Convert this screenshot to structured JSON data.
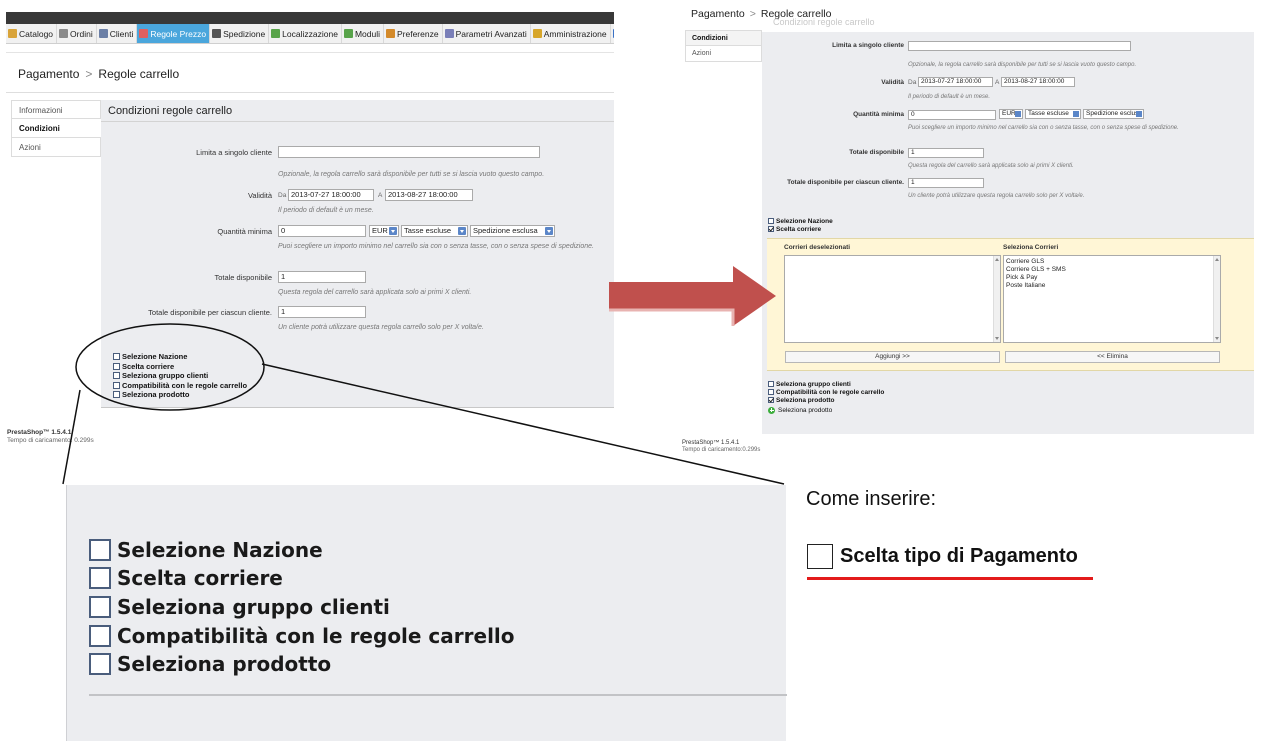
{
  "left": {
    "menu": [
      {
        "label": "Catalogo",
        "icon": "catalog-icon",
        "color": "#d9a43a"
      },
      {
        "label": "Ordini",
        "icon": "cart-icon",
        "color": "#8a8a8a"
      },
      {
        "label": "Clienti",
        "icon": "customers-icon",
        "color": "#6b7fa6"
      },
      {
        "label": "Regole Prezzo",
        "icon": "price-rules-icon",
        "color": "#e06060",
        "active": true
      },
      {
        "label": "Spedizione",
        "icon": "truck-icon",
        "color": "#555555"
      },
      {
        "label": "Localizzazione",
        "icon": "globe-icon",
        "color": "#59a44a"
      },
      {
        "label": "Moduli",
        "icon": "puzzle-icon",
        "color": "#58a34a"
      },
      {
        "label": "Preferenze",
        "icon": "preferences-icon",
        "color": "#d48a2a"
      },
      {
        "label": "Parametri Avanzati",
        "icon": "wrench-icon",
        "color": "#7a7fb8"
      },
      {
        "label": "Amministrazione",
        "icon": "key-icon",
        "color": "#d7a62a"
      },
      {
        "label": "S",
        "icon": "stats-icon",
        "color": "#3b72c6"
      }
    ],
    "breadcrumb": {
      "parent": "Pagamento",
      "separator": ">",
      "current": "Regole carrello"
    },
    "tabs": [
      "Informazioni",
      "Condizioni",
      "Azioni"
    ],
    "panel_title": "Condizioni regole carrello",
    "form": {
      "customer_label": "Limita a singolo cliente",
      "customer_value": "",
      "customer_hint": "Opzionale, la regola carrello sarà disponibile per tutti se si lascia vuoto questo campo.",
      "validity_label": "Validità",
      "from_label": "Da",
      "from_value": "2013-07-27 18:00:00",
      "to_label": "A",
      "to_value": "2013-08-27 18:00:00",
      "validity_hint": "Il periodo di default è un mese.",
      "min_label": "Quantità minima",
      "min_value": "0",
      "currency": "EUR",
      "tax": "Tasse escluse",
      "shipping": "Spedizione esclusa",
      "min_hint": "Puoi scegliere un importo minimo nel carrello sia con o senza tasse, con o senza spese di spedizione.",
      "total_label": "Totale disponibile",
      "total_value": "1",
      "total_hint": "Questa regola del carrello sarà applicata solo ai primi X clienti.",
      "per_customer_label": "Totale disponibile per ciascun cliente.",
      "per_customer_value": "1",
      "per_customer_hint": "Un cliente potrà utilizzare questa regola carrello solo per X volta/e."
    },
    "checkboxes": [
      "Selezione Nazione",
      "Scelta corriere",
      "Seleziona gruppo clienti",
      "Compatibilità con le regole carrello",
      "Seleziona prodotto"
    ],
    "footer_version": "PrestaShop™ 1.5.4.1",
    "footer_load": "Tempo di caricamento: 0.299s"
  },
  "right": {
    "breadcrumb": {
      "parent": "Pagamento",
      "separator": ">",
      "current": "Regole carrello"
    },
    "ghost_title": "Condizioni regole carrello",
    "tabs": [
      "Condizioni",
      "Azioni"
    ],
    "form": {
      "customer_label": "Limita a singolo cliente",
      "customer_hint": "Opzionale, la regola carrello sarà disponibile per tutti se si lascia vuoto questo campo.",
      "validity_label": "Validità",
      "from_label": "Da",
      "from_value": "2013-07-27 18:00:00",
      "to_label": "A",
      "to_value": "2013-08-27 18:00:00",
      "validity_hint": "Il periodo di default è un mese.",
      "min_label": "Quantità minima",
      "min_value": "0",
      "currency": "EUR",
      "tax": "Tasse escluse",
      "shipping": "Spedizione esclusa",
      "min_hint": "Puoi scegliere un importo minimo nel carrello sia con o senza tasse, con o senza spese di spedizione.",
      "total_label": "Totale disponibile",
      "total_value": "1",
      "total_hint": "Questa regola del carrello sarà applicata solo ai primi X clienti.",
      "per_customer_label": "Totale disponibile per ciascun cliente.",
      "per_customer_value": "1",
      "per_customer_hint": "Un cliente potrà utilizzare questa regola carrello solo per X volta/e."
    },
    "checkboxes_top": [
      {
        "label": "Selezione Nazione",
        "checked": false
      },
      {
        "label": "Scelta corriere",
        "checked": true
      }
    ],
    "carriers": {
      "unselected_title": "Corrieri deselezionati",
      "selected_title": "Seleziona Corrieri",
      "selected": [
        "Corriere GLS",
        "Corriere GLS + SMS",
        "Pick & Pay",
        "Poste Italiane"
      ],
      "add_label": "Aggiungi >>",
      "remove_label": "<< Elimina"
    },
    "checkboxes_bottom": [
      {
        "label": "Seleziona gruppo clienti",
        "checked": false
      },
      {
        "label": "Compatibilità con le regole carrello",
        "checked": false
      },
      {
        "label": "Seleziona prodotto",
        "checked": true
      }
    ],
    "add_product_label": "Seleziona prodotto",
    "footer_version": "PrestaShop™ 1.5.4.1",
    "footer_load": "Tempo di caricamento:0.299s"
  },
  "zoom": {
    "checkboxes": [
      "Selezione Nazione",
      "Scelta corriere",
      "Seleziona gruppo clienti",
      "Compatibilità con le regole carrello",
      "Seleziona prodotto"
    ]
  },
  "note": {
    "title": "Come inserire:",
    "proposed_label": "Scelta tipo di Pagamento",
    "underline_color": "#e31b1b"
  },
  "arrow": {
    "color": "#c0504d"
  }
}
